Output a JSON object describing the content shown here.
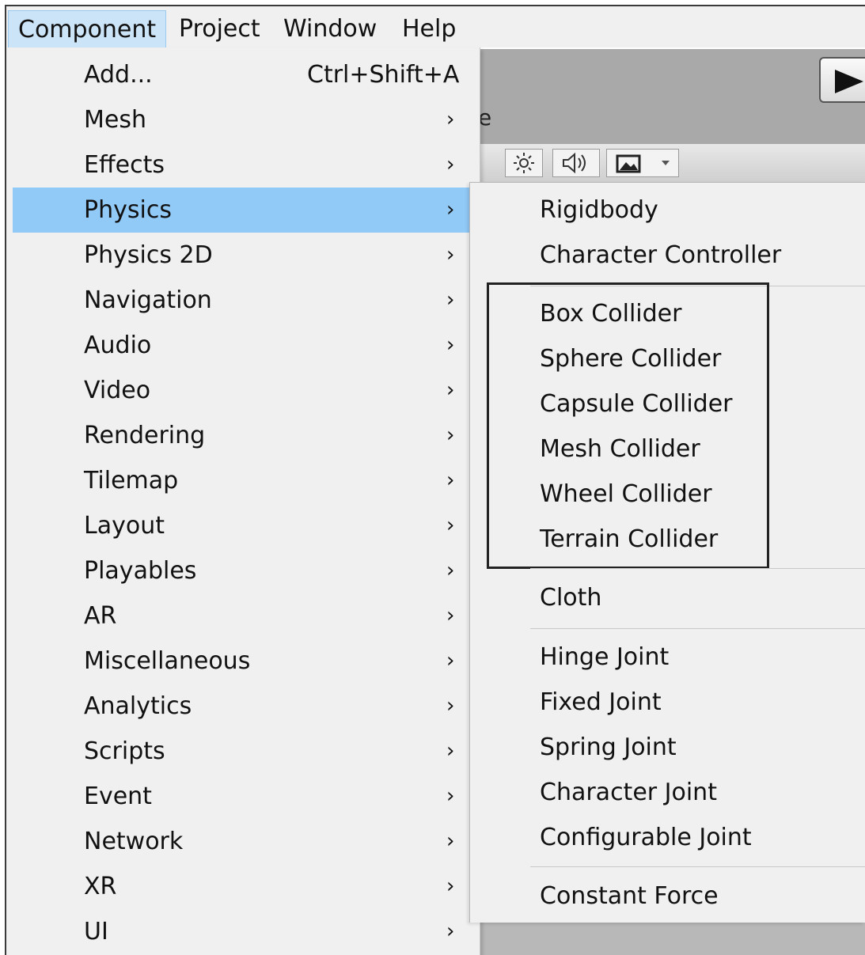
{
  "menubar": {
    "items": [
      {
        "label": "Component",
        "open": true
      },
      {
        "label": "Project"
      },
      {
        "label": "Window"
      },
      {
        "label": "Help"
      }
    ]
  },
  "component_menu": {
    "items": [
      {
        "label": "Add...",
        "shortcut": "Ctrl+Shift+A"
      },
      {
        "label": "Mesh",
        "arrow": "›"
      },
      {
        "label": "Effects",
        "arrow": "›"
      },
      {
        "label": "Physics",
        "arrow": "›",
        "highlighted": true
      },
      {
        "label": "Physics 2D",
        "arrow": "›"
      },
      {
        "label": "Navigation",
        "arrow": "›"
      },
      {
        "label": "Audio",
        "arrow": "›"
      },
      {
        "label": "Video",
        "arrow": "›"
      },
      {
        "label": "Rendering",
        "arrow": "›"
      },
      {
        "label": "Tilemap",
        "arrow": "›"
      },
      {
        "label": "Layout",
        "arrow": "›"
      },
      {
        "label": "Playables",
        "arrow": "›"
      },
      {
        "label": "AR",
        "arrow": "›"
      },
      {
        "label": "Miscellaneous",
        "arrow": "›"
      },
      {
        "label": "Analytics",
        "arrow": "›"
      },
      {
        "label": "Scripts",
        "arrow": "›"
      },
      {
        "label": "Event",
        "arrow": "›"
      },
      {
        "label": "Network",
        "arrow": "›"
      },
      {
        "label": "XR",
        "arrow": "›"
      },
      {
        "label": "UI",
        "arrow": "›"
      }
    ]
  },
  "physics_submenu": {
    "items": [
      {
        "label": "Rigidbody"
      },
      {
        "label": "Character Controller"
      },
      {
        "label": "Box Collider"
      },
      {
        "label": "Sphere Collider"
      },
      {
        "label": "Capsule Collider"
      },
      {
        "label": "Mesh Collider"
      },
      {
        "label": "Wheel Collider"
      },
      {
        "label": "Terrain Collider"
      },
      {
        "label": "Cloth"
      },
      {
        "label": "Hinge Joint"
      },
      {
        "label": "Fixed Joint"
      },
      {
        "label": "Spring Joint"
      },
      {
        "label": "Character Joint"
      },
      {
        "label": "Configurable Joint"
      },
      {
        "label": "Constant Force"
      }
    ]
  },
  "editor": {
    "partial_label": "e",
    "toolbar_icons": [
      "sun-icon",
      "speaker-icon",
      "image-icon",
      "dropdown-arrow-icon"
    ],
    "play_icon": "play-icon"
  },
  "colors": {
    "menu_bg": "#f0f0f0",
    "highlight": "#91c9f7",
    "menubar_open": "#cce4f7",
    "editor_bg": "#a9a9a9"
  }
}
